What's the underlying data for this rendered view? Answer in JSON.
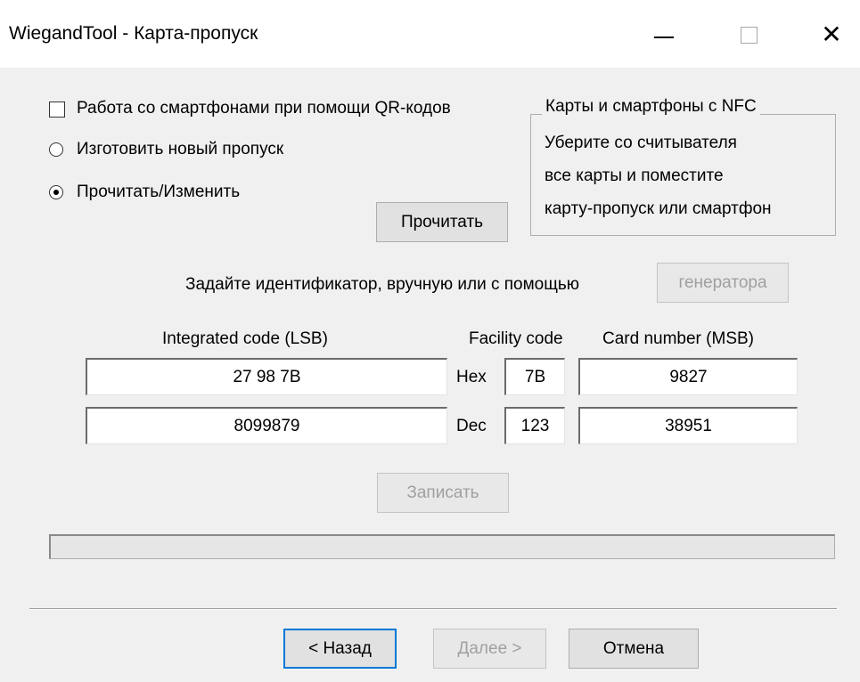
{
  "window": {
    "title": "WiegandTool - Карта-пропуск"
  },
  "options": {
    "qr_checkbox_label": "Работа со смартфонами при помощи QR-кодов",
    "qr_checked": false,
    "radio_new_label": "Изготовить новый пропуск",
    "radio_read_label": "Прочитать/Изменить",
    "selected": "read"
  },
  "nfc_group": {
    "title": "Карты и смартфоны с  NFC",
    "lines": [
      "Уберите со считывателя",
      "все карты и поместите",
      "карту-пропуск или смартфон"
    ]
  },
  "buttons": {
    "read": "Прочитать",
    "generator": "генератора",
    "write": "Записать",
    "back": "< Назад",
    "next": "Далее >",
    "cancel": "Отмена"
  },
  "hint": "Задайте идентификатор, вручную или с помощью",
  "columns": {
    "integrated": "Integrated code (LSB)",
    "facility": "Facility code",
    "card": "Card number (MSB)"
  },
  "rows": [
    {
      "label": "Hex",
      "integrated": "27 98 7B",
      "facility": "7B",
      "card": "9827"
    },
    {
      "label": "Dec",
      "integrated": "8099879",
      "facility": "123",
      "card": "38951"
    }
  ],
  "progress": 0
}
